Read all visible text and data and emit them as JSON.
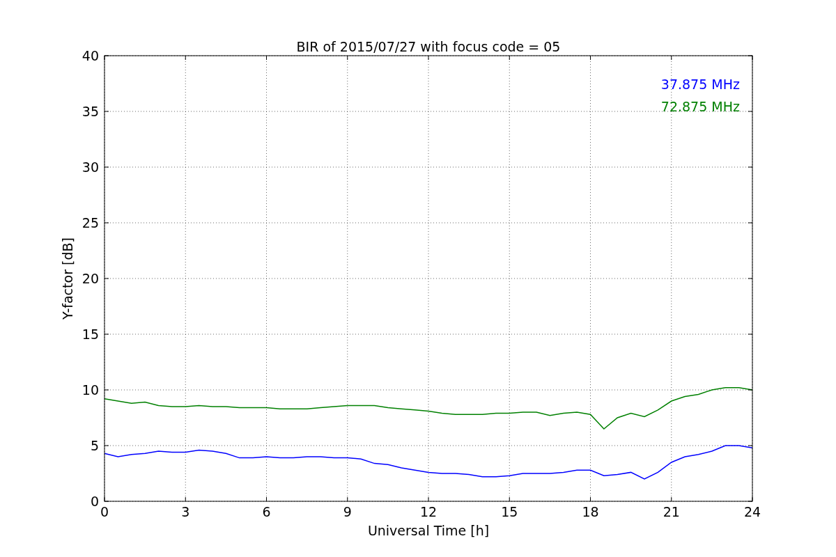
{
  "figure": {
    "chart_data": {
      "type": "line",
      "title": "BIR of 2015/07/27 with focus code = 05",
      "xlabel": "Universal Time [h]",
      "ylabel": "Y-factor [dB]",
      "x": [
        0,
        0.5,
        1,
        1.5,
        2,
        2.5,
        3,
        3.5,
        4,
        4.5,
        5,
        5.5,
        6,
        6.5,
        7,
        7.5,
        8,
        8.5,
        9,
        9.5,
        10,
        10.5,
        11,
        11.5,
        12,
        12.5,
        13,
        13.5,
        14,
        14.5,
        15,
        15.5,
        16,
        16.5,
        17,
        17.5,
        18,
        18.5,
        19,
        19.5,
        20,
        20.5,
        21,
        21.5,
        22,
        22.5,
        23,
        23.5,
        24
      ],
      "series": [
        {
          "name": "37.875 MHz",
          "color": "#0000ff",
          "values": [
            4.3,
            4.0,
            4.2,
            4.3,
            4.5,
            4.4,
            4.4,
            4.6,
            4.5,
            4.3,
            3.9,
            3.9,
            4.0,
            3.9,
            3.9,
            4.0,
            4.0,
            3.9,
            3.9,
            3.8,
            3.4,
            3.3,
            3.0,
            2.8,
            2.6,
            2.5,
            2.5,
            2.4,
            2.2,
            2.2,
            2.3,
            2.5,
            2.5,
            2.5,
            2.6,
            2.8,
            2.8,
            2.3,
            2.4,
            2.6,
            2.0,
            2.6,
            3.5,
            4.0,
            4.2,
            4.5,
            5.0,
            5.0,
            4.8
          ]
        },
        {
          "name": "72.875 MHz",
          "color": "#008000",
          "values": [
            9.2,
            9.0,
            8.8,
            8.9,
            8.6,
            8.5,
            8.5,
            8.6,
            8.5,
            8.5,
            8.4,
            8.4,
            8.4,
            8.3,
            8.3,
            8.3,
            8.4,
            8.5,
            8.6,
            8.6,
            8.6,
            8.4,
            8.3,
            8.2,
            8.1,
            7.9,
            7.8,
            7.8,
            7.8,
            7.9,
            7.9,
            8.0,
            8.0,
            7.7,
            7.9,
            8.0,
            7.8,
            6.5,
            7.5,
            7.9,
            7.6,
            8.2,
            9.0,
            9.4,
            9.6,
            10.0,
            10.2,
            10.2,
            10.0
          ]
        }
      ],
      "xlim": [
        0,
        24
      ],
      "ylim": [
        0,
        40
      ],
      "xticks": [
        0,
        3,
        6,
        9,
        12,
        15,
        18,
        21,
        24
      ],
      "yticks": [
        0,
        5,
        10,
        15,
        20,
        25,
        30,
        35,
        40
      ],
      "grid": true
    }
  }
}
